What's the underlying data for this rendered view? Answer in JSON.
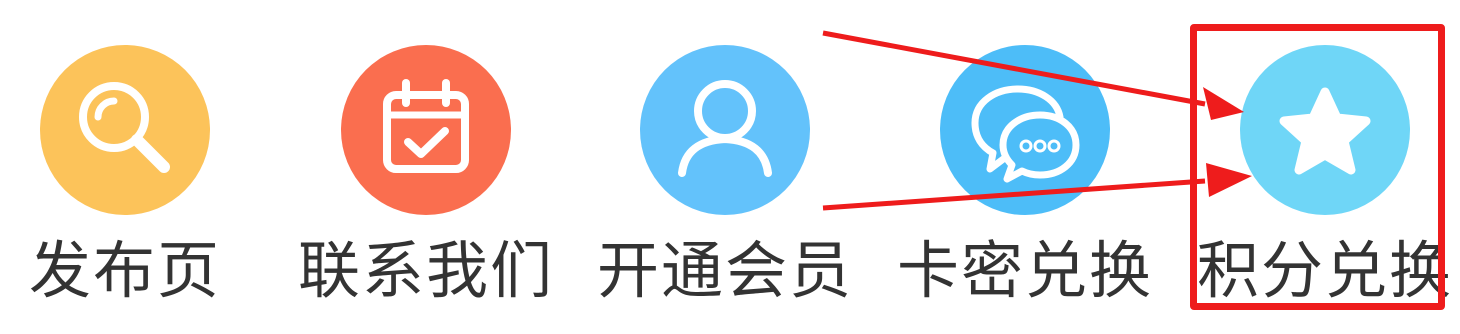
{
  "nav": {
    "items": [
      {
        "label": "发布页",
        "icon": "search-icon",
        "color": "#fcc35a"
      },
      {
        "label": "联系我们",
        "icon": "calendar-check-icon",
        "color": "#fa6e4f"
      },
      {
        "label": "开通会员",
        "icon": "user-icon",
        "color": "#63c2fb"
      },
      {
        "label": "卡密兑换",
        "icon": "chat-bubbles-icon",
        "color": "#4dbdf8"
      },
      {
        "label": "积分兑换",
        "icon": "star-icon",
        "color": "#6fd6f7"
      }
    ]
  },
  "annotation": {
    "color": "#ee1c1c",
    "highlighted_item": "积分兑换"
  }
}
